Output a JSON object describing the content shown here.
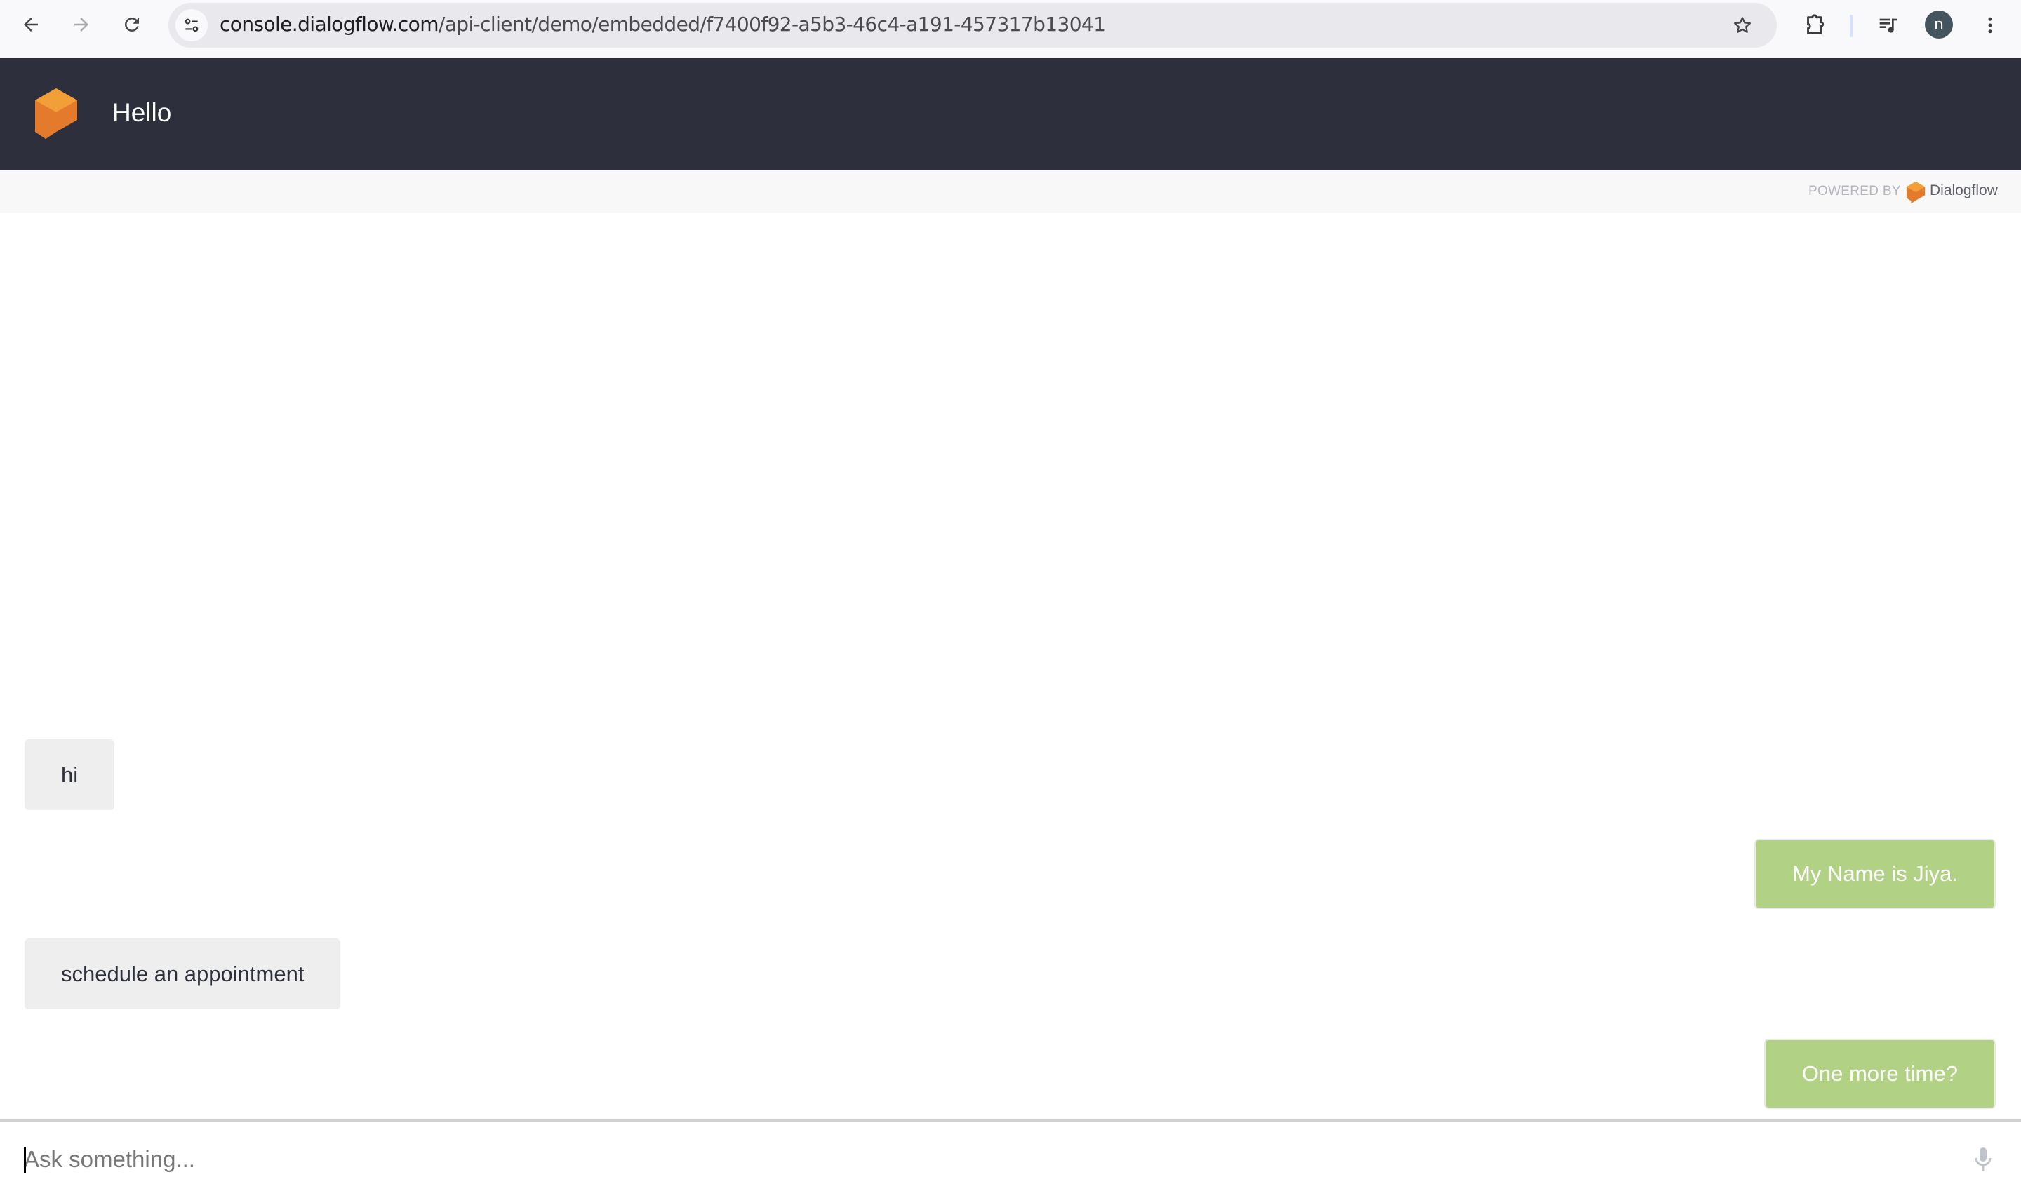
{
  "browser": {
    "url_domain": "console.dialogflow.com",
    "url_path": "/api-client/demo/embedded/f7400f92-a5b3-46c4-a191-457317b13041",
    "avatar_initial": "n",
    "icons": {
      "back": "arrow-left-icon",
      "forward": "arrow-right-icon",
      "reload": "reload-icon",
      "site_info": "tune-icon",
      "bookmark": "star-icon",
      "extensions": "puzzle-icon",
      "media": "queue-music-icon",
      "menu": "more-vert-icon"
    }
  },
  "header": {
    "title": "Hello",
    "logo": "dialogflow-logo-icon",
    "brand_color": "#ef8a2d",
    "background": "#2d303c"
  },
  "powered_by": {
    "label": "POWERED BY",
    "brand": "Dialogflow"
  },
  "chat": {
    "messages": [
      {
        "side": "bot",
        "text": "hi"
      },
      {
        "side": "user",
        "text": "My Name is Jiya."
      },
      {
        "side": "bot",
        "text": "schedule an appointment"
      },
      {
        "side": "user",
        "text": "One more time?"
      }
    ],
    "colors": {
      "bot_bubble": "#eeeeee",
      "user_bubble": "#b1d184"
    }
  },
  "input": {
    "placeholder": "Ask something...",
    "value": "",
    "mic_icon": "microphone-icon"
  }
}
